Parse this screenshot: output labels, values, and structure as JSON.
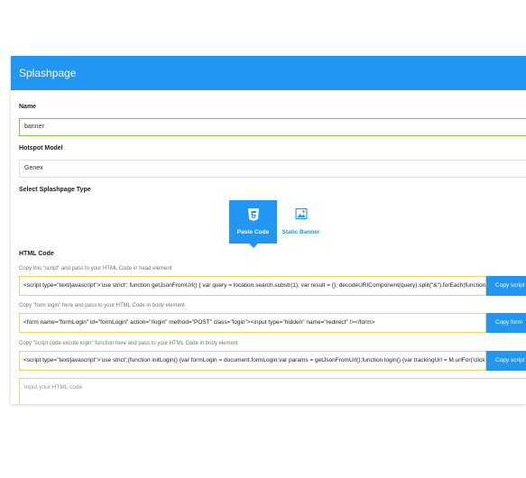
{
  "header": {
    "title": "Splashpage"
  },
  "name_field": {
    "label": "Name",
    "value": "banner"
  },
  "hotspot_field": {
    "label": "Hotspot Model",
    "value": "Genex"
  },
  "type_selector": {
    "label": "Select Splashpage Type",
    "options": [
      {
        "label": "Paste Code",
        "icon": "html5-icon",
        "active": true
      },
      {
        "label": "Static Banner",
        "icon": "image-icon",
        "active": false
      }
    ]
  },
  "html_code": {
    "label": "HTML Code",
    "blocks": [
      {
        "hint": "Copy this \"script\" and pass to your HTML Code in head element",
        "code": "<script type=\"text/javascript\">'use strict'; function getJsonFromUrl() { var query = location.search.substr(1); var result = {}; decodeURIComponent(query).split(\"&\").forEach(function (part) { var item = p",
        "button": "Copy script"
      },
      {
        "hint": "Copy \"form login\" here and pass to your HTML Code in body element",
        "code": "<form name=\"formLogin\" id=\"formLogin\" action=\"/login\" method=\"POST\" class=\"login\"><input type=\"hidden\" name=\"redirect\" /></form>",
        "button": "Copy form"
      },
      {
        "hint": "Copy \"script code excute login\" function here and pass to your HTML Code in body element",
        "code": "<script type=\"text/javascript\">'use strict';(function initLogin() {var formLogin = document.formLogin;var params = getJsonFromUrl();function login() {var trackingUrl = M.urlFor('click');formLogin.elemen",
        "button": "Copy script login"
      }
    ],
    "textarea_placeholder": "Input your HTML code"
  }
}
